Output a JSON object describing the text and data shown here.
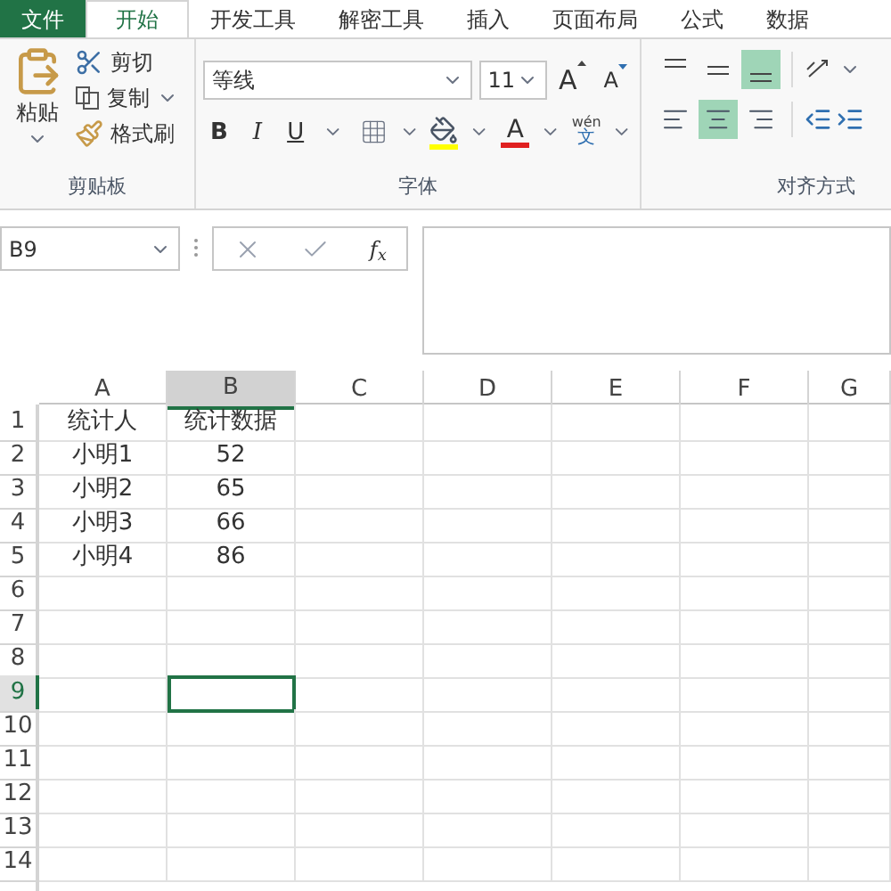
{
  "tabs": [
    {
      "label": "文件",
      "kind": "file",
      "selected": false
    },
    {
      "label": "开始",
      "kind": "tab",
      "selected": true
    },
    {
      "label": "开发工具",
      "kind": "tab",
      "selected": false
    },
    {
      "label": "解密工具",
      "kind": "tab",
      "selected": false
    },
    {
      "label": "插入",
      "kind": "tab",
      "selected": false
    },
    {
      "label": "页面布局",
      "kind": "tab",
      "selected": false
    },
    {
      "label": "公式",
      "kind": "tab",
      "selected": false
    },
    {
      "label": "数据",
      "kind": "tab",
      "selected": false
    }
  ],
  "clipboard": {
    "paste": "粘贴",
    "cut": "剪切",
    "copy": "复制",
    "format_painter": "格式刷",
    "group_label": "剪贴板"
  },
  "font": {
    "name": "等线",
    "size": "11",
    "grow": "A",
    "shrink": "A",
    "bold": "B",
    "italic": "I",
    "underline": "U",
    "font_color": "A",
    "phonetic_top": "wén",
    "phonetic_bottom": "文",
    "group_label": "字体"
  },
  "alignment": {
    "vertical": [
      {
        "kind": "top",
        "selected": false
      },
      {
        "kind": "middle",
        "selected": false
      },
      {
        "kind": "bottom",
        "selected": true
      }
    ],
    "horizontal": [
      {
        "kind": "left",
        "selected": false
      },
      {
        "kind": "center",
        "selected": true
      },
      {
        "kind": "right",
        "selected": false
      }
    ],
    "group_label": "对齐方式"
  },
  "name_box": "B9",
  "formula_bar": {
    "fx": "f$_{x}$"
  },
  "columns": [
    {
      "label": "A",
      "selected": false
    },
    {
      "label": "B",
      "selected": true
    },
    {
      "label": "C",
      "selected": false
    },
    {
      "label": "D",
      "selected": false
    },
    {
      "label": "E",
      "selected": false
    },
    {
      "label": "F",
      "selected": false
    },
    {
      "label": "G",
      "selected": false
    }
  ],
  "rows": [
    {
      "label": "1",
      "selected": false,
      "cells": [
        {
          "text": "统计人",
          "selected": false
        },
        {
          "text": "统计数据",
          "selected": false
        }
      ]
    },
    {
      "label": "2",
      "selected": false,
      "cells": [
        {
          "text": "小明1",
          "selected": false
        },
        {
          "text": "52",
          "selected": false
        }
      ]
    },
    {
      "label": "3",
      "selected": false,
      "cells": [
        {
          "text": "小明2",
          "selected": false
        },
        {
          "text": "65",
          "selected": false
        }
      ]
    },
    {
      "label": "4",
      "selected": false,
      "cells": [
        {
          "text": "小明3",
          "selected": false
        },
        {
          "text": "66",
          "selected": false
        }
      ]
    },
    {
      "label": "5",
      "selected": false,
      "cells": [
        {
          "text": "小明4",
          "selected": false
        },
        {
          "text": "86",
          "selected": false
        }
      ]
    },
    {
      "label": "6",
      "selected": false
    },
    {
      "label": "7",
      "selected": false
    },
    {
      "label": "8",
      "selected": false
    },
    {
      "label": "9",
      "selected": true,
      "cells": [
        {
          "selected": false
        },
        {
          "selected": true
        }
      ]
    },
    {
      "label": "10",
      "selected": false
    },
    {
      "label": "11",
      "selected": false
    },
    {
      "label": "12",
      "selected": false
    },
    {
      "label": "13",
      "selected": false
    },
    {
      "label": "14",
      "selected": false
    }
  ]
}
